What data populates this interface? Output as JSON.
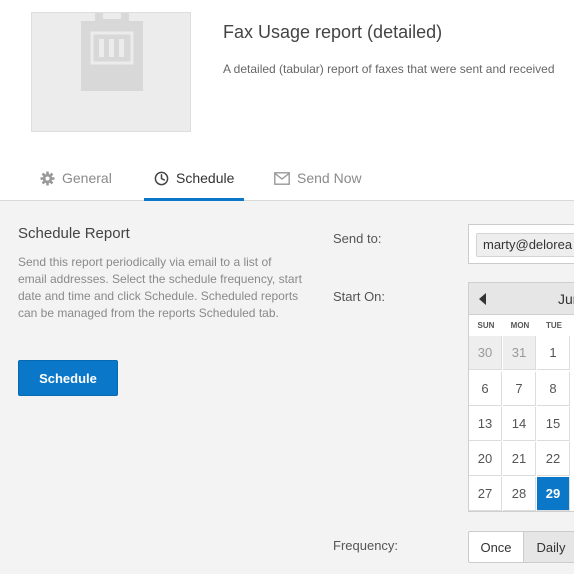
{
  "report": {
    "title": "Fax Usage report (detailed)",
    "description": "A detailed (tabular) report of faxes that were sent and received"
  },
  "tabs": [
    {
      "label": "General",
      "icon": "gear-icon",
      "active": false
    },
    {
      "label": "Schedule",
      "icon": "clock-icon",
      "active": true
    },
    {
      "label": "Send Now",
      "icon": "envelope-icon",
      "active": false
    }
  ],
  "schedule": {
    "heading": "Schedule Report",
    "help": "Send this report periodically via email to a list of email addresses. Select the schedule frequency, start date and time and click Schedule. Scheduled reports can be managed from the reports Scheduled tab.",
    "button_label": "Schedule"
  },
  "form": {
    "send_to_label": "Send to:",
    "send_to_value": "marty@delorea",
    "start_on_label": "Start On:",
    "frequency_label": "Frequency:"
  },
  "calendar": {
    "month_label": "Jur",
    "days_of_week": [
      "SUN",
      "MON",
      "TUE"
    ],
    "weeks": [
      [
        "30",
        "31",
        "1"
      ],
      [
        "6",
        "7",
        "8"
      ],
      [
        "13",
        "14",
        "15"
      ],
      [
        "20",
        "21",
        "22"
      ],
      [
        "27",
        "28",
        "29"
      ]
    ],
    "selected_day": "29",
    "muted_days": [
      "30",
      "31"
    ]
  },
  "frequency": {
    "options": [
      "Once",
      "Daily"
    ],
    "selected": "Daily"
  },
  "colors": {
    "accent": "#0a77c8",
    "panel_bg": "#f3f3f3"
  }
}
